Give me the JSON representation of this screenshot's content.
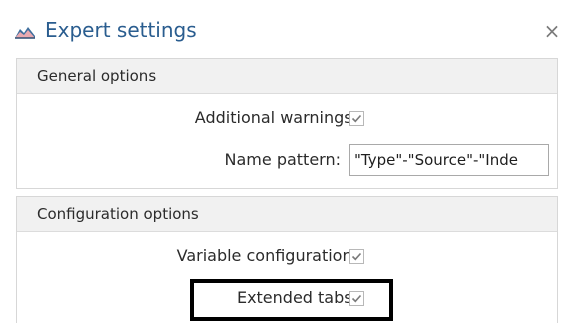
{
  "window": {
    "title": "Expert settings",
    "close_glyph": "×",
    "icon": "chart-mountain-icon"
  },
  "general": {
    "header": "General options",
    "additional_warnings": {
      "label": "Additional warnings:",
      "checked": true
    },
    "name_pattern": {
      "label": "Name pattern:",
      "value": "\"Type\"-\"Source\"-\"Inde"
    }
  },
  "configuration": {
    "header": "Configuration options",
    "variable_configuration": {
      "label": "Variable configuration:",
      "checked": true
    },
    "extended_tabs": {
      "label": "Extended tabs:",
      "checked": true
    }
  },
  "colors": {
    "title": "#2a5d8f",
    "check": "#7a7a7a",
    "highlight": "#000000"
  }
}
